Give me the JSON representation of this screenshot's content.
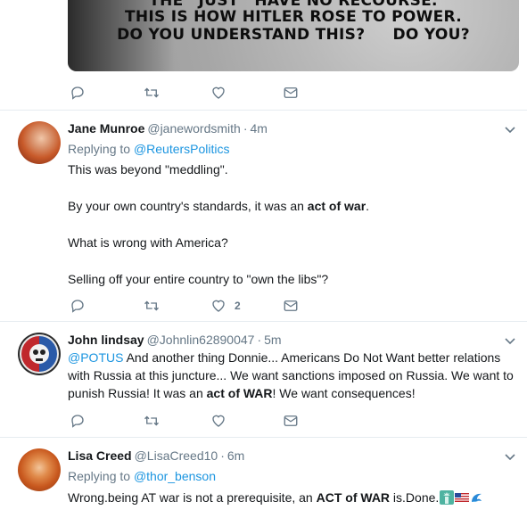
{
  "top_tweet": {
    "meme_lines": [
      "THE “JUST” HAVE NO RECOURSE.",
      "THIS IS HOW HITLER ROSE TO POWER.",
      "DO YOU UNDERSTAND THIS?     DO YOU?"
    ]
  },
  "tweets": [
    {
      "name": "Jane Munroe",
      "handle": "@janewordsmith",
      "time": "4m",
      "replying_label": "Replying to",
      "replying_to": "@ReutersPolitics",
      "p1": "This was beyond \"meddling\".",
      "p2_pre": "By your own country's standards, it was an ",
      "p2_bold": "act of war",
      "p2_post": ".",
      "p3": "What is wrong with America?",
      "p4": "Selling off your entire country to \"own the libs\"?",
      "like_count": "2"
    },
    {
      "name": "John lindsay",
      "handle": "@Johnlin62890047",
      "time": "5m",
      "mention": "@POTUS",
      "text_a": " And another thing Donnie... Americans Do Not Want better relations with Russia at this juncture... We want sanctions imposed on Russia. We want to punish Russia! It was an ",
      "text_bold": "act of WAR",
      "text_b": "! We want consequences!"
    },
    {
      "name": "Lisa Creed",
      "handle": "@LisaCreed10",
      "time": "6m",
      "replying_label": "Replying to",
      "replying_to": "@thor_benson",
      "text_a": "Wrong.being AT war is not a prerequisite, an ",
      "text_bold": "ACT of WAR",
      "text_b": " is.Done."
    }
  ],
  "dot": "·",
  "icons": {
    "reply": "reply-icon",
    "retweet": "retweet-icon",
    "like": "heart-icon",
    "message": "envelope-icon",
    "more": "chevron-down-icon"
  },
  "colors": {
    "link": "#1b95e0",
    "muted": "#657786",
    "text": "#14171a",
    "divider": "#e6ecf0"
  }
}
